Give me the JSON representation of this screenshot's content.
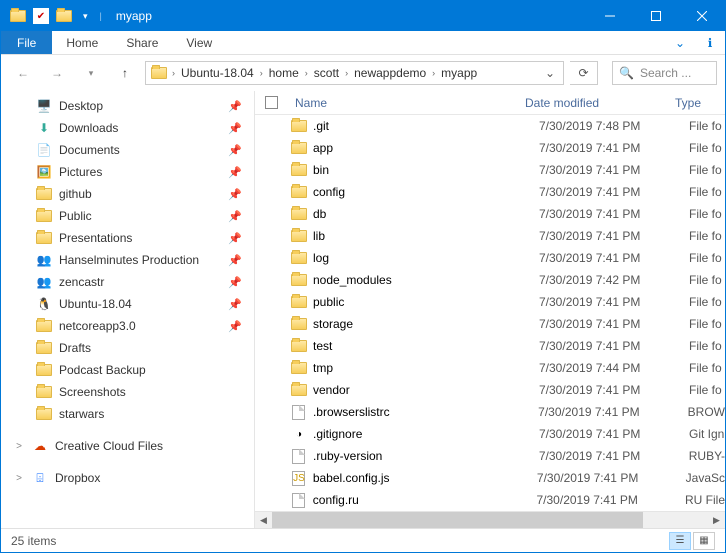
{
  "window": {
    "title": "myapp"
  },
  "ribbon": {
    "file": "File",
    "tabs": [
      "Home",
      "Share",
      "View"
    ]
  },
  "breadcrumb": [
    "Ubuntu-18.04",
    "home",
    "scott",
    "newappdemo",
    "myapp"
  ],
  "search": {
    "placeholder": "Search ..."
  },
  "nav": {
    "quick_access": [
      {
        "label": "Desktop",
        "icon": "desktop",
        "pinned": true
      },
      {
        "label": "Downloads",
        "icon": "downloads",
        "pinned": true
      },
      {
        "label": "Documents",
        "icon": "documents",
        "pinned": true
      },
      {
        "label": "Pictures",
        "icon": "pictures",
        "pinned": true
      },
      {
        "label": "github",
        "icon": "folder",
        "pinned": true
      },
      {
        "label": "Public",
        "icon": "folder",
        "pinned": true
      },
      {
        "label": "Presentations",
        "icon": "folder",
        "pinned": true
      },
      {
        "label": "Hanselminutes Production",
        "icon": "people",
        "pinned": true
      },
      {
        "label": "zencastr",
        "icon": "people",
        "pinned": true
      },
      {
        "label": "Ubuntu-18.04",
        "icon": "linux",
        "pinned": true
      },
      {
        "label": "netcoreapp3.0",
        "icon": "folder",
        "pinned": true
      },
      {
        "label": "Drafts",
        "icon": "folder",
        "pinned": false
      },
      {
        "label": "Podcast Backup",
        "icon": "folder",
        "pinned": false
      },
      {
        "label": "Screenshots",
        "icon": "folder",
        "pinned": false
      },
      {
        "label": "starwars",
        "icon": "folder",
        "pinned": false
      }
    ],
    "roots": [
      {
        "label": "Creative Cloud Files",
        "icon": "cc",
        "exp": ">"
      },
      {
        "label": "Dropbox",
        "icon": "dropbox",
        "exp": ">"
      }
    ]
  },
  "columns": {
    "name": "Name",
    "date": "Date modified",
    "type": "Type"
  },
  "files": [
    {
      "name": ".git",
      "date": "7/30/2019 7:48 PM",
      "type": "File fo",
      "kind": "folder"
    },
    {
      "name": "app",
      "date": "7/30/2019 7:41 PM",
      "type": "File fo",
      "kind": "folder"
    },
    {
      "name": "bin",
      "date": "7/30/2019 7:41 PM",
      "type": "File fo",
      "kind": "folder"
    },
    {
      "name": "config",
      "date": "7/30/2019 7:41 PM",
      "type": "File fo",
      "kind": "folder"
    },
    {
      "name": "db",
      "date": "7/30/2019 7:41 PM",
      "type": "File fo",
      "kind": "folder"
    },
    {
      "name": "lib",
      "date": "7/30/2019 7:41 PM",
      "type": "File fo",
      "kind": "folder"
    },
    {
      "name": "log",
      "date": "7/30/2019 7:41 PM",
      "type": "File fo",
      "kind": "folder"
    },
    {
      "name": "node_modules",
      "date": "7/30/2019 7:42 PM",
      "type": "File fo",
      "kind": "folder"
    },
    {
      "name": "public",
      "date": "7/30/2019 7:41 PM",
      "type": "File fo",
      "kind": "folder"
    },
    {
      "name": "storage",
      "date": "7/30/2019 7:41 PM",
      "type": "File fo",
      "kind": "folder"
    },
    {
      "name": "test",
      "date": "7/30/2019 7:41 PM",
      "type": "File fo",
      "kind": "folder"
    },
    {
      "name": "tmp",
      "date": "7/30/2019 7:44 PM",
      "type": "File fo",
      "kind": "folder"
    },
    {
      "name": "vendor",
      "date": "7/30/2019 7:41 PM",
      "type": "File fo",
      "kind": "folder"
    },
    {
      "name": ".browserslistrc",
      "date": "7/30/2019 7:41 PM",
      "type": "BROW",
      "kind": "file"
    },
    {
      "name": ".gitignore",
      "date": "7/30/2019 7:41 PM",
      "type": "Git Ign",
      "kind": "gitignore"
    },
    {
      "name": ".ruby-version",
      "date": "7/30/2019 7:41 PM",
      "type": "RUBY-",
      "kind": "file"
    },
    {
      "name": "babel.config.js",
      "date": "7/30/2019 7:41 PM",
      "type": "JavaSc",
      "kind": "js"
    },
    {
      "name": "config.ru",
      "date": "7/30/2019 7:41 PM",
      "type": "RU File",
      "kind": "file"
    }
  ],
  "status": {
    "count": "25 items"
  }
}
